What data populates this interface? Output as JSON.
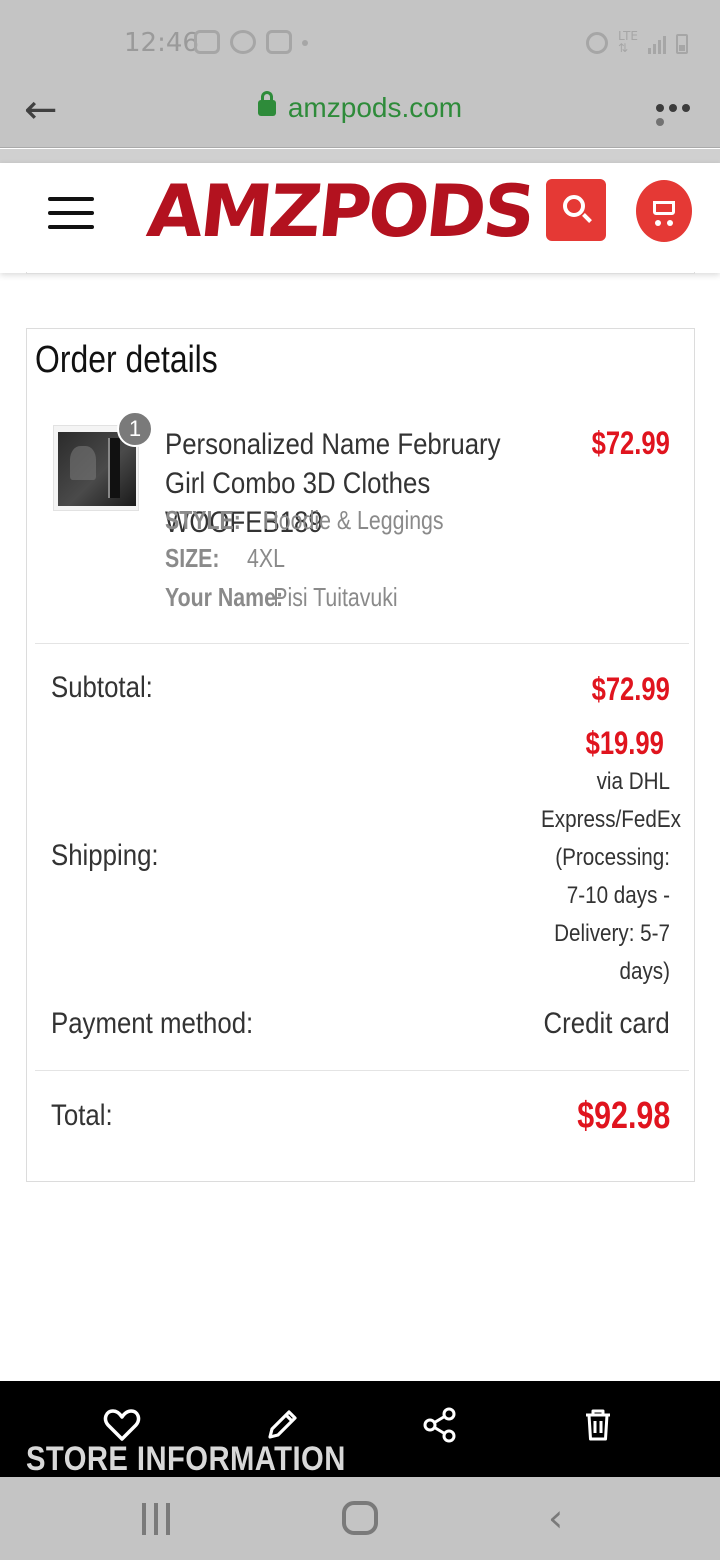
{
  "status_bar": {
    "time": "12:46"
  },
  "browser": {
    "url": "amzpods.com"
  },
  "site": {
    "logo_text": "AMZPODS"
  },
  "order": {
    "title": "Order details",
    "item": {
      "quantity": "1",
      "name": "Personalized Name February Girl Combo 3D Clothes WOOFEB189",
      "price": "$72.99",
      "style_label": "STYLE:",
      "style_value": "Hoodie & Leggings",
      "size_label": "SIZE:",
      "size_value": "4XL",
      "name_label": "Your Name:",
      "name_value": "Pisi Tuitavuki"
    },
    "subtotal_label": "Subtotal:",
    "subtotal_value": "$72.99",
    "shipping_label": "Shipping:",
    "shipping_value": "$19.99",
    "shipping_method": "via DHL Express/FedEx (Processing: 7-10 days - Delivery: 5-7 days)",
    "payment_label": "Payment method:",
    "payment_value": "Credit card",
    "total_label": "Total:",
    "total_value": "$92.98"
  },
  "footer": {
    "store_info": "STORE INFORMATION"
  },
  "colors": {
    "accent": "#e0141e",
    "brand": "#b3121f",
    "url_green": "#2e8b3a"
  }
}
